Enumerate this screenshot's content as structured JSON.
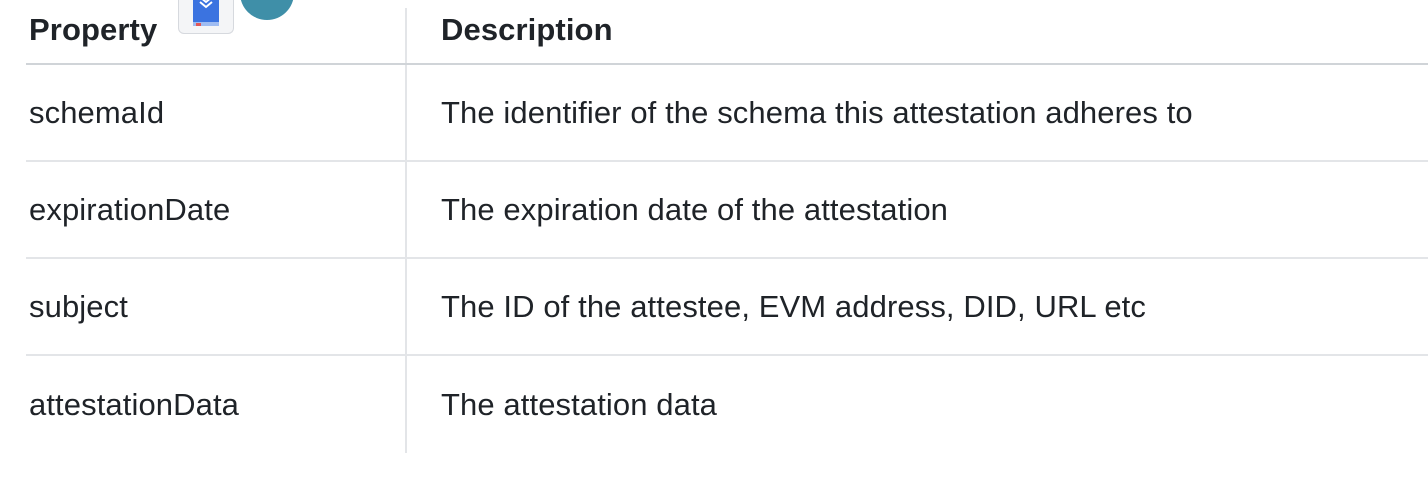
{
  "table": {
    "headers": {
      "property": "Property",
      "description": "Description"
    },
    "rows": [
      {
        "property": "schemaId",
        "description": "The identifier of the schema this attestation adheres to"
      },
      {
        "property": "expirationDate",
        "description": "The expiration date of the attestation"
      },
      {
        "property": "subject",
        "description": "The ID of the attestee, EVM address, DID, URL etc"
      },
      {
        "property": "attestationData",
        "description": "The attestation data"
      }
    ]
  },
  "overlay_icons": {
    "book_icon": "bookmark-book-icon",
    "circle_icon": "circle-avatar-icon"
  },
  "colors": {
    "text": "#1f2328",
    "border": "#e3e5e8",
    "header_border": "#d0d4d8",
    "book_icon_blue": "#3b73e0",
    "circle_icon": "#3f8fa8"
  }
}
